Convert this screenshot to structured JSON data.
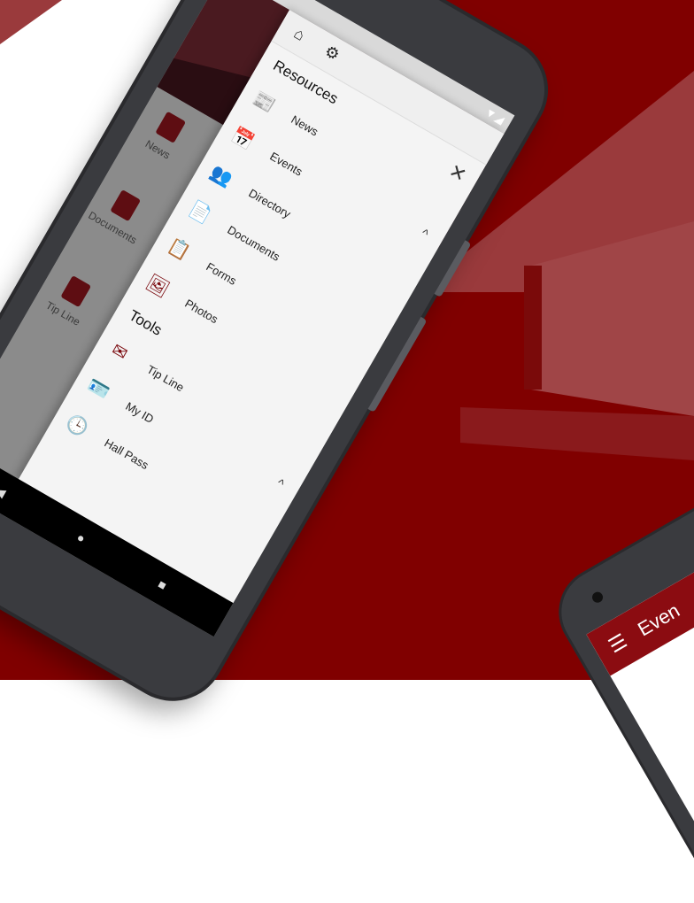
{
  "colors": {
    "brand": "#7b0b10",
    "brand_dark": "#5e0d12",
    "background_red": "#7f0000"
  },
  "status_bar": {
    "icons": "▼◢"
  },
  "background_app": {
    "tiles": [
      {
        "label": "News"
      },
      {
        "label": "Documents"
      },
      {
        "label": "Tip Line"
      }
    ]
  },
  "drawer": {
    "top_icons": [
      "home-icon",
      "account-settings-icon"
    ],
    "close_symbol": "✕",
    "resources": {
      "title": "Resources",
      "collapse_symbol": "^",
      "items": [
        {
          "label": "News",
          "icon": "newspaper-icon",
          "glyph": "📰"
        },
        {
          "label": "Events",
          "icon": "calendar-icon",
          "glyph": "📅"
        },
        {
          "label": "Directory",
          "icon": "people-icon",
          "glyph": "👥"
        },
        {
          "label": "Documents",
          "icon": "document-icon",
          "glyph": "📄"
        },
        {
          "label": "Forms",
          "icon": "form-icon",
          "glyph": "📋"
        },
        {
          "label": "Photos",
          "icon": "photos-icon",
          "glyph": "🖼"
        }
      ]
    },
    "tools": {
      "title": "Tools",
      "collapse_symbol": "^",
      "items": [
        {
          "label": "Tip Line",
          "icon": "envelope-icon",
          "glyph": "✉"
        },
        {
          "label": "My ID",
          "icon": "id-card-icon",
          "glyph": "🪪"
        },
        {
          "label": "Hall Pass",
          "icon": "clock-icon",
          "glyph": "🕒"
        }
      ]
    }
  },
  "nav_bar": {
    "back": "◀",
    "home": "●",
    "recents": "■"
  },
  "second_phone": {
    "menu_symbol": "☰",
    "title": "Even"
  }
}
